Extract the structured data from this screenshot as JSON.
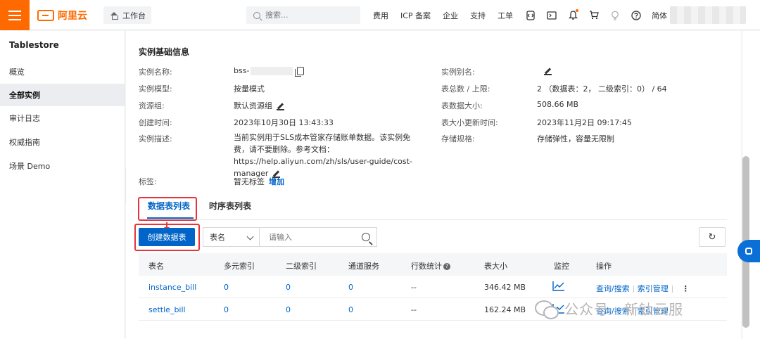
{
  "topbar": {
    "logo_text": "阿里云",
    "workbench_label": "工作台",
    "search_placeholder": "搜索...",
    "nav": [
      "费用",
      "ICP 备案",
      "企业",
      "支持",
      "工单"
    ],
    "language": "简体"
  },
  "sidebar": {
    "title": "Tablestore",
    "items": [
      {
        "label": "概览",
        "active": false
      },
      {
        "label": "全部实例",
        "active": true
      },
      {
        "label": "审计日志",
        "active": false
      },
      {
        "label": "权威指南",
        "active": false
      },
      {
        "label": "场景 Demo",
        "active": false
      }
    ]
  },
  "instance_info": {
    "title": "实例基础信息",
    "name_label": "实例名称:",
    "name_value": "bss-",
    "model_label": "实例模型:",
    "model_value": "按量模式",
    "resource_group_label": "资源组:",
    "resource_group_value": "默认资源组",
    "created_label": "创建时间:",
    "created_value": "2023年10月30日 13:43:33",
    "desc_label": "实例描述:",
    "desc_value": "当前实例用于SLS成本管家存储账单数据。该实例免费，请不要删除。参考文档：https://help.aliyun.com/zh/sls/user-guide/cost-manager",
    "alias_label": "实例别名:",
    "table_count_label": "表总数 / 上限:",
    "table_count_value": "2 （数据表：2， 二级索引：0） / 64",
    "data_size_label": "表数据大小:",
    "data_size_value": "508.66 MB",
    "size_updated_label": "表大小更新时间:",
    "size_updated_value": "2023年11月2日 09:17:45",
    "storage_label": "存储规格:",
    "storage_value": "存储弹性，容量无限制",
    "tags_label": "标签:",
    "tags_value": "暂无标签",
    "tags_add": "增加"
  },
  "tabs": {
    "data_tables": "数据表列表",
    "timeseries_tables": "时序表列表"
  },
  "toolbar": {
    "create_button": "创建数据表",
    "filter_select": "表名",
    "filter_placeholder": "请输入"
  },
  "table": {
    "headers": [
      "表名",
      "多元索引",
      "二级索引",
      "通道服务",
      "行数统计",
      "表大小",
      "监控",
      "操作"
    ],
    "rows": [
      {
        "name": "instance_bill",
        "search_index": "0",
        "secondary_index": "0",
        "tunnel": "0",
        "rows": "--",
        "size": "346.42 MB",
        "action_query": "查询/搜索",
        "action_index": "索引管理"
      },
      {
        "name": "settle_bill",
        "search_index": "0",
        "secondary_index": "0",
        "tunnel": "0",
        "rows": "--",
        "size": "162.24 MB",
        "action_query": "查询/搜索",
        "action_index": "索引管理"
      }
    ]
  },
  "watermark": "公众号 · 新钛云服",
  "colors": {
    "brand": "#ff6a00",
    "primary": "#0064c8",
    "highlight": "#e5343c"
  }
}
